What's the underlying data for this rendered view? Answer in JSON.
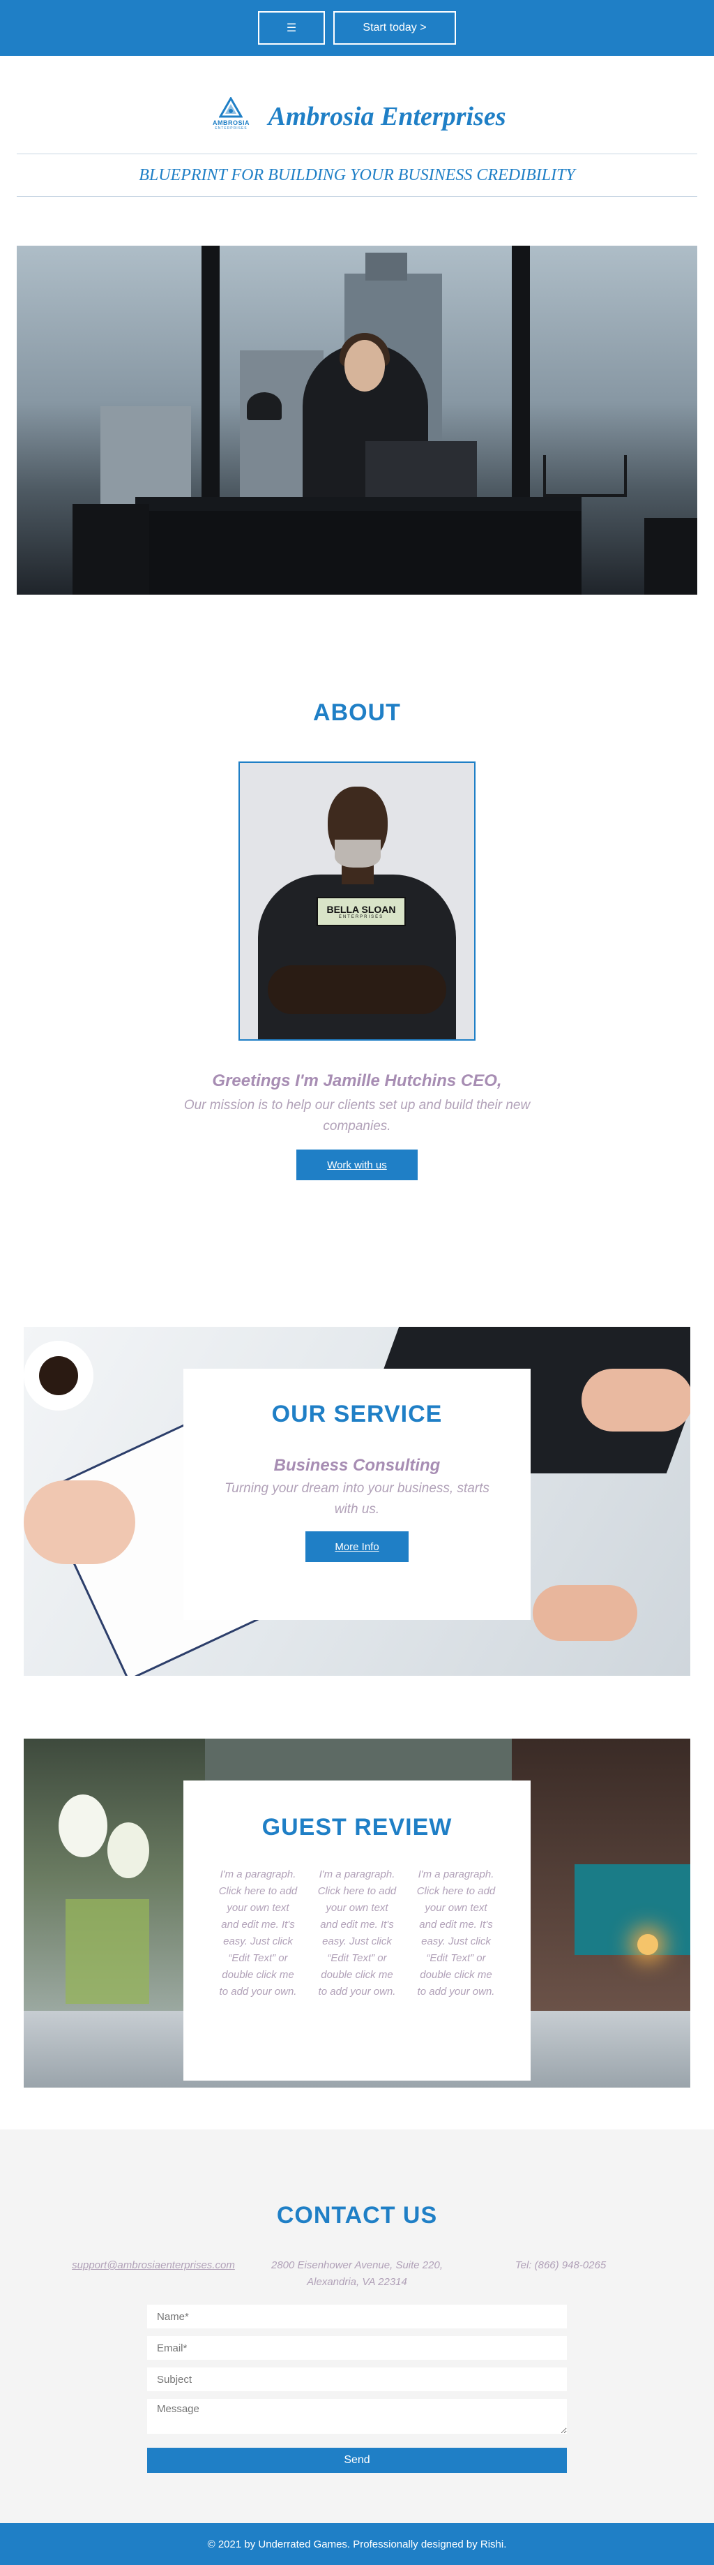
{
  "topbar": {
    "menu_label": "☰",
    "start_label": "Start today >"
  },
  "brand": {
    "logo_text": "AMBROSIA",
    "logo_sub": "ENTERPRISES",
    "company_name": "Ambrosia Enterprises",
    "tagline": "BLUEPRINT FOR BUILDING YOUR BUSINESS CREDIBILITY"
  },
  "about": {
    "title": "ABOUT",
    "badge_main": "BELLA SLOAN",
    "badge_sub": "ENTERPRISES",
    "greeting": "Greetings I'm Jamille Hutchins CEO,",
    "mission": "Our mission is to help our clients set up and build their new companies.",
    "button": "Work with us"
  },
  "service": {
    "title": "OUR SERVICE",
    "subtitle": "Business Consulting",
    "text": "Turning your dream into your business, starts with us.",
    "button": "More Info"
  },
  "review": {
    "title": "GUEST REVIEW",
    "columns": [
      "I'm a paragraph. Click here to add your own text and edit me. It's easy. Just click “Edit Text” or double click me to add your own.",
      "I'm a paragraph. Click here to add your own text and edit me. It's easy. Just click “Edit Text” or double click me to add your own.",
      "I'm a paragraph. Click here to add your own text and edit me. It's easy. Just click “Edit Text” or double click me to add your own."
    ]
  },
  "contact": {
    "title": "CONTACT US",
    "email": "support@ambrosiaenterprises.com",
    "address": "2800 Eisenhower Avenue, Suite 220, Alexandria, VA 22314",
    "phone": "Tel: (866) 948-0265",
    "form": {
      "name_placeholder": "Name*",
      "email_placeholder": "Email*",
      "subject_placeholder": "Subject",
      "message_placeholder": "Message",
      "send_label": "Send"
    }
  },
  "footer": {
    "text": "© 2021 by Underrated Games. Professionally designed by Rishi."
  },
  "colors": {
    "brand_blue": "#1f7fc6",
    "text_purple": "#a78db3",
    "text_muted": "#b1a1b8",
    "contact_bg": "#f4f4f4"
  }
}
